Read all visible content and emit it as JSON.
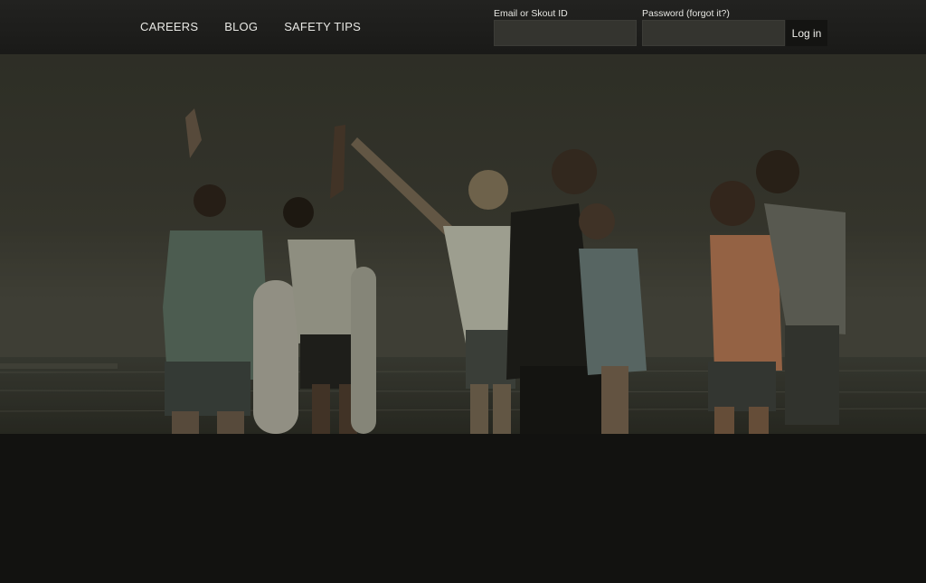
{
  "nav": {
    "items": [
      {
        "label": "CAREERS"
      },
      {
        "label": "BLOG"
      },
      {
        "label": "SAFETY TIPS"
      }
    ]
  },
  "login": {
    "email_label": "Email or Skout ID",
    "email_value": "",
    "password_label": "Password (forgot it?)",
    "password_value": "",
    "submit_label": "Log in"
  },
  "colors": {
    "topbar": "#1e1e1c",
    "page_background": "#121210",
    "hero_tint": "#2a2b22"
  }
}
